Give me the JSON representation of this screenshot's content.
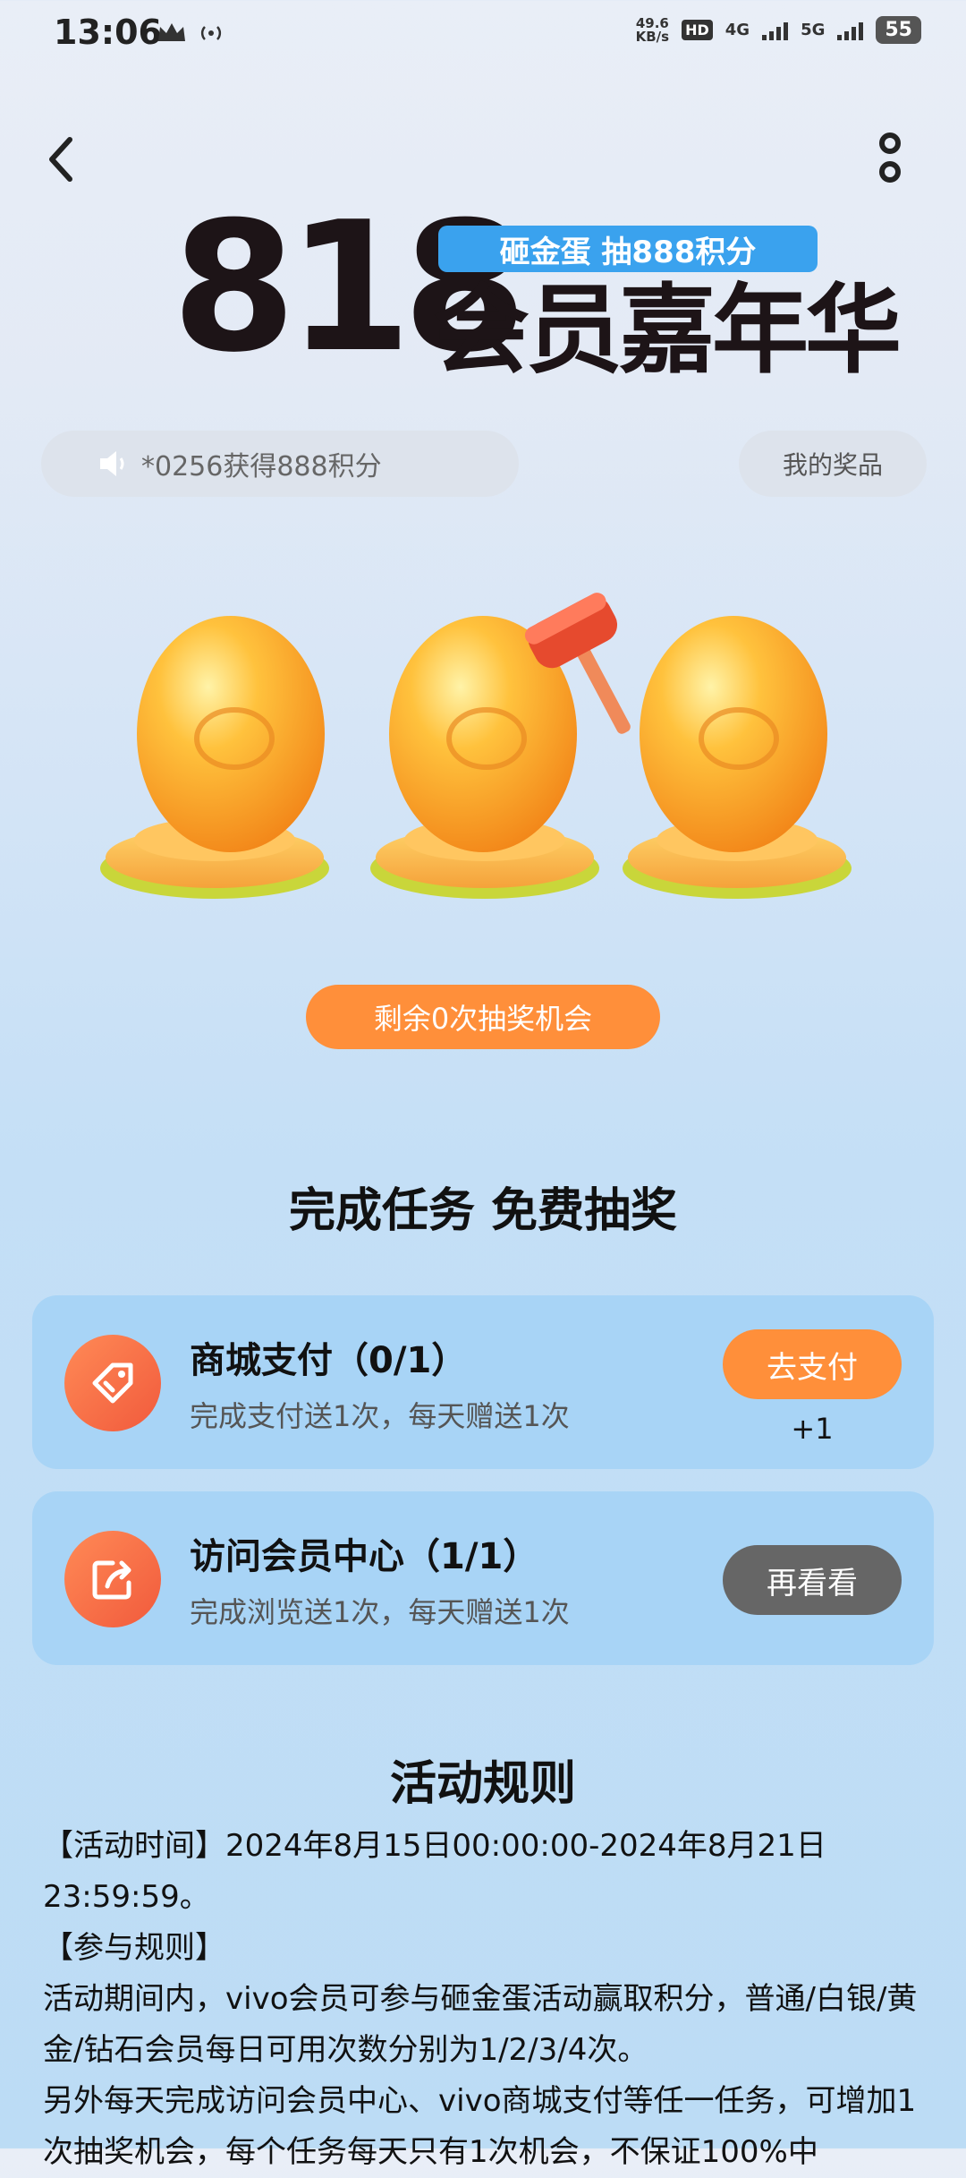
{
  "status_bar": {
    "time": "13:06",
    "net_speed_value": "49.6",
    "net_speed_unit": "KB/s",
    "hd_label": "HD",
    "sim1_label": "4G",
    "sim2_label": "5G",
    "battery": "55"
  },
  "hero": {
    "number": "818",
    "pill_text": "砸金蛋  抽888积分",
    "subtitle": "会员嘉年华"
  },
  "marquee": {
    "text": "*0256获得888积分"
  },
  "prize_button": {
    "label": "我的奖品"
  },
  "draw": {
    "remaining_label": "剩余0次抽奖机会"
  },
  "tasks_section": {
    "title": "完成任务 免费抽奖",
    "tasks": [
      {
        "title": "商城支付（0/1）",
        "desc": "完成支付送1次，每天赠送1次",
        "button": "去支付",
        "reward": "+1",
        "icon": "tag-icon"
      },
      {
        "title": "访问会员中心（1/1）",
        "desc": "完成浏览送1次，每天赠送1次",
        "button": "再看看",
        "icon": "share-icon"
      }
    ]
  },
  "rules": {
    "title": "活动规则",
    "lines": [
      "【活动时间】2024年8月15日00:00:00-2024年8月21日23:59:59。",
      "【参与规则】",
      "活动期间内，vivo会员可参与砸金蛋活动赢取积分，普通/白银/黄金/钻石会员每日可用次数分别为1/2/3/4次。",
      "另外每天完成访问会员中心、vivo商城支付等任一任务，可增加1次抽奖机会，每个任务每天只有1次机会，不保证100%中"
    ]
  },
  "colors": {
    "accent_orange": "#ff8f3a",
    "pill_blue": "#3aa2ee",
    "card_blue": "#a8d4f6",
    "button_gray": "#666666"
  }
}
